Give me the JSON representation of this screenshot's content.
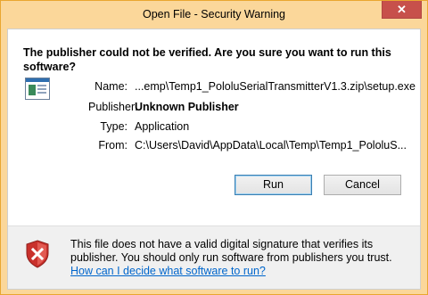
{
  "window": {
    "title": "Open File - Security Warning",
    "close_glyph": "✕"
  },
  "question": "The publisher could not be verified.  Are you sure you want to run this software?",
  "details": {
    "name_label": "Name:",
    "name_value": "...emp\\Temp1_PololuSerialTransmitterV1.3.zip\\setup.exe",
    "publisher_label": "Publisher:",
    "publisher_value": "Unknown Publisher",
    "type_label": "Type:",
    "type_value": "Application",
    "from_label": "From:",
    "from_value": "C:\\Users\\David\\AppData\\Local\\Temp\\Temp1_PololuS..."
  },
  "buttons": {
    "run": "Run",
    "cancel": "Cancel"
  },
  "footer": {
    "warning_text": "This file does not have a valid digital signature that verifies its publisher.  You should only run software from publishers you trust.",
    "help_link": "How can I decide what software to run?"
  },
  "colors": {
    "titlebar": "#fbd79a",
    "close_button": "#c7504b",
    "link": "#0066cc",
    "shield_red": "#c9312c"
  },
  "icons": {
    "app": "application-window-icon",
    "shield": "security-shield-error-icon"
  }
}
